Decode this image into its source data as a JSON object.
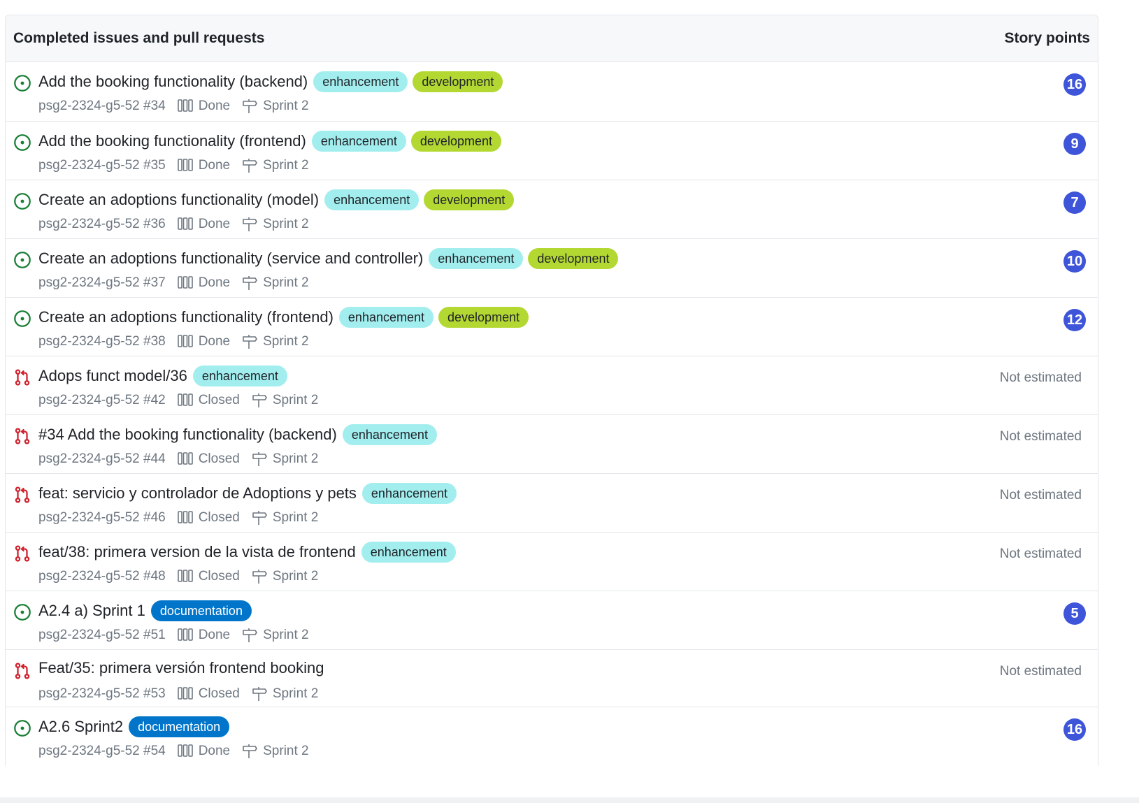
{
  "header": {
    "title": "Completed issues and pull requests",
    "points_label": "Story points"
  },
  "colors": {
    "open_issue": "#1a7f37",
    "pull_request": "#cf222e",
    "points_badge": "#3e55d9",
    "enhancement": "#a2eeef",
    "development": "#b4d832",
    "documentation": "#0075ca"
  },
  "items": [
    {
      "type": "issue",
      "status_icon": "issue-open-icon",
      "title": "Add the booking functionality (backend)",
      "labels": [
        {
          "name": "enhancement"
        },
        {
          "name": "development"
        }
      ],
      "repo_ref": "psg2-2324-g5-52 #34",
      "status": "Done",
      "iteration": "Sprint 2",
      "points": "16"
    },
    {
      "type": "issue",
      "status_icon": "issue-open-icon",
      "title": "Add the booking functionality (frontend)",
      "labels": [
        {
          "name": "enhancement"
        },
        {
          "name": "development"
        }
      ],
      "repo_ref": "psg2-2324-g5-52 #35",
      "status": "Done",
      "iteration": "Sprint 2",
      "points": "9"
    },
    {
      "type": "issue",
      "status_icon": "issue-open-icon",
      "title": "Create an adoptions functionality (model)",
      "labels": [
        {
          "name": "enhancement"
        },
        {
          "name": "development"
        }
      ],
      "repo_ref": "psg2-2324-g5-52 #36",
      "status": "Done",
      "iteration": "Sprint 2",
      "points": "7"
    },
    {
      "type": "issue",
      "status_icon": "issue-open-icon",
      "title": "Create an adoptions functionality (service and controller)",
      "labels": [
        {
          "name": "enhancement"
        },
        {
          "name": "development"
        }
      ],
      "repo_ref": "psg2-2324-g5-52 #37",
      "status": "Done",
      "iteration": "Sprint 2",
      "points": "10"
    },
    {
      "type": "issue",
      "status_icon": "issue-open-icon",
      "title": "Create an adoptions functionality (frontend)",
      "labels": [
        {
          "name": "enhancement"
        },
        {
          "name": "development"
        }
      ],
      "repo_ref": "psg2-2324-g5-52 #38",
      "status": "Done",
      "iteration": "Sprint 2",
      "points": "12"
    },
    {
      "type": "pr",
      "status_icon": "pull-request-closed-icon",
      "title": "Adops funct model/36",
      "labels": [
        {
          "name": "enhancement"
        }
      ],
      "repo_ref": "psg2-2324-g5-52 #42",
      "status": "Closed",
      "iteration": "Sprint 2",
      "not_estimated": "Not estimated"
    },
    {
      "type": "pr",
      "status_icon": "pull-request-closed-icon",
      "title": "#34 Add the booking functionality (backend)",
      "labels": [
        {
          "name": "enhancement"
        }
      ],
      "repo_ref": "psg2-2324-g5-52 #44",
      "status": "Closed",
      "iteration": "Sprint 2",
      "not_estimated": "Not estimated"
    },
    {
      "type": "pr",
      "status_icon": "pull-request-closed-icon",
      "title": "feat: servicio y controlador de Adoptions y pets",
      "labels": [
        {
          "name": "enhancement"
        }
      ],
      "repo_ref": "psg2-2324-g5-52 #46",
      "status": "Closed",
      "iteration": "Sprint 2",
      "not_estimated": "Not estimated"
    },
    {
      "type": "pr",
      "status_icon": "pull-request-closed-icon",
      "title": "feat/38: primera version de la vista de frontend",
      "labels": [
        {
          "name": "enhancement"
        }
      ],
      "repo_ref": "psg2-2324-g5-52 #48",
      "status": "Closed",
      "iteration": "Sprint 2",
      "not_estimated": "Not estimated"
    },
    {
      "type": "issue",
      "status_icon": "issue-open-icon",
      "title": "A2.4 a) Sprint 1",
      "labels": [
        {
          "name": "documentation"
        }
      ],
      "repo_ref": "psg2-2324-g5-52 #51",
      "status": "Done",
      "iteration": "Sprint 2",
      "points": "5"
    },
    {
      "type": "pr",
      "status_icon": "pull-request-closed-icon",
      "title": "Feat/35: primera versión frontend booking",
      "labels": [],
      "repo_ref": "psg2-2324-g5-52 #53",
      "status": "Closed",
      "iteration": "Sprint 2",
      "not_estimated": "Not estimated"
    },
    {
      "type": "issue",
      "status_icon": "issue-open-icon",
      "title": "A2.6 Sprint2",
      "labels": [
        {
          "name": "documentation"
        }
      ],
      "repo_ref": "psg2-2324-g5-52 #54",
      "status": "Done",
      "iteration": "Sprint 2",
      "points": "16"
    }
  ]
}
